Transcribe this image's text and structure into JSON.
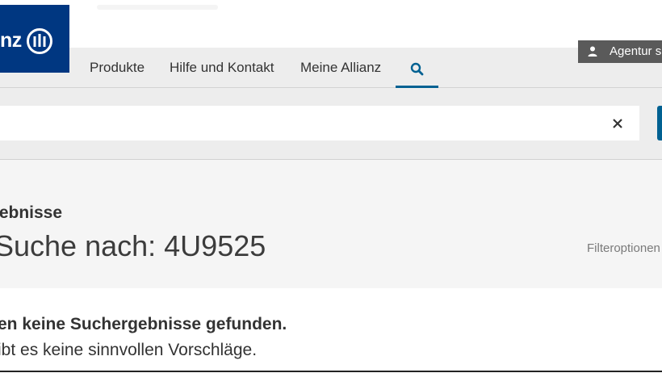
{
  "header": {
    "logo_text": "nz",
    "logo_emblem": "allianz-eagle-icon",
    "nav": [
      {
        "label": "Produkte"
      },
      {
        "label": "Hilfe und Kontakt"
      },
      {
        "label": "Meine Allianz"
      }
    ],
    "search_icon": "search-icon",
    "agency_button_label": "Agentur s",
    "agency_icon": "person-icon"
  },
  "search": {
    "value": "",
    "placeholder": "",
    "clear_icon": "close-icon"
  },
  "results": {
    "heading": "gebnisse",
    "query_line": "Suche nach: 4U9525",
    "filter_label": "Filteroptionen",
    "no_results": "en keine Suchergebnisse gefunden.",
    "no_suggestions": "ibt es keine sinnvollen Vorschläge."
  },
  "colors": {
    "brand": "#003781",
    "accent": "#006192",
    "nav_bg": "#ededed",
    "agency_bg": "#5a5a5a"
  }
}
